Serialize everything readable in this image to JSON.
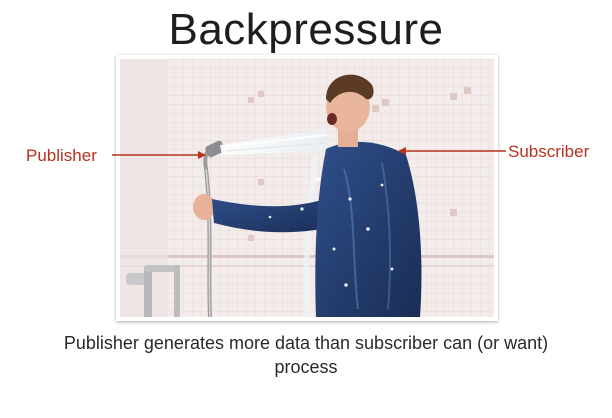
{
  "slide": {
    "title": "Backpressure",
    "labels": {
      "publisher": "Publisher",
      "subscriber": "Subscriber"
    },
    "caption": {
      "line1": "Publisher generates more data than subscriber can (or want)",
      "line2": "process"
    }
  },
  "colors": {
    "label": "#b8321e",
    "arrow": "#b8321e",
    "title": "#1e1e1e",
    "shirt": "#243c6e"
  }
}
